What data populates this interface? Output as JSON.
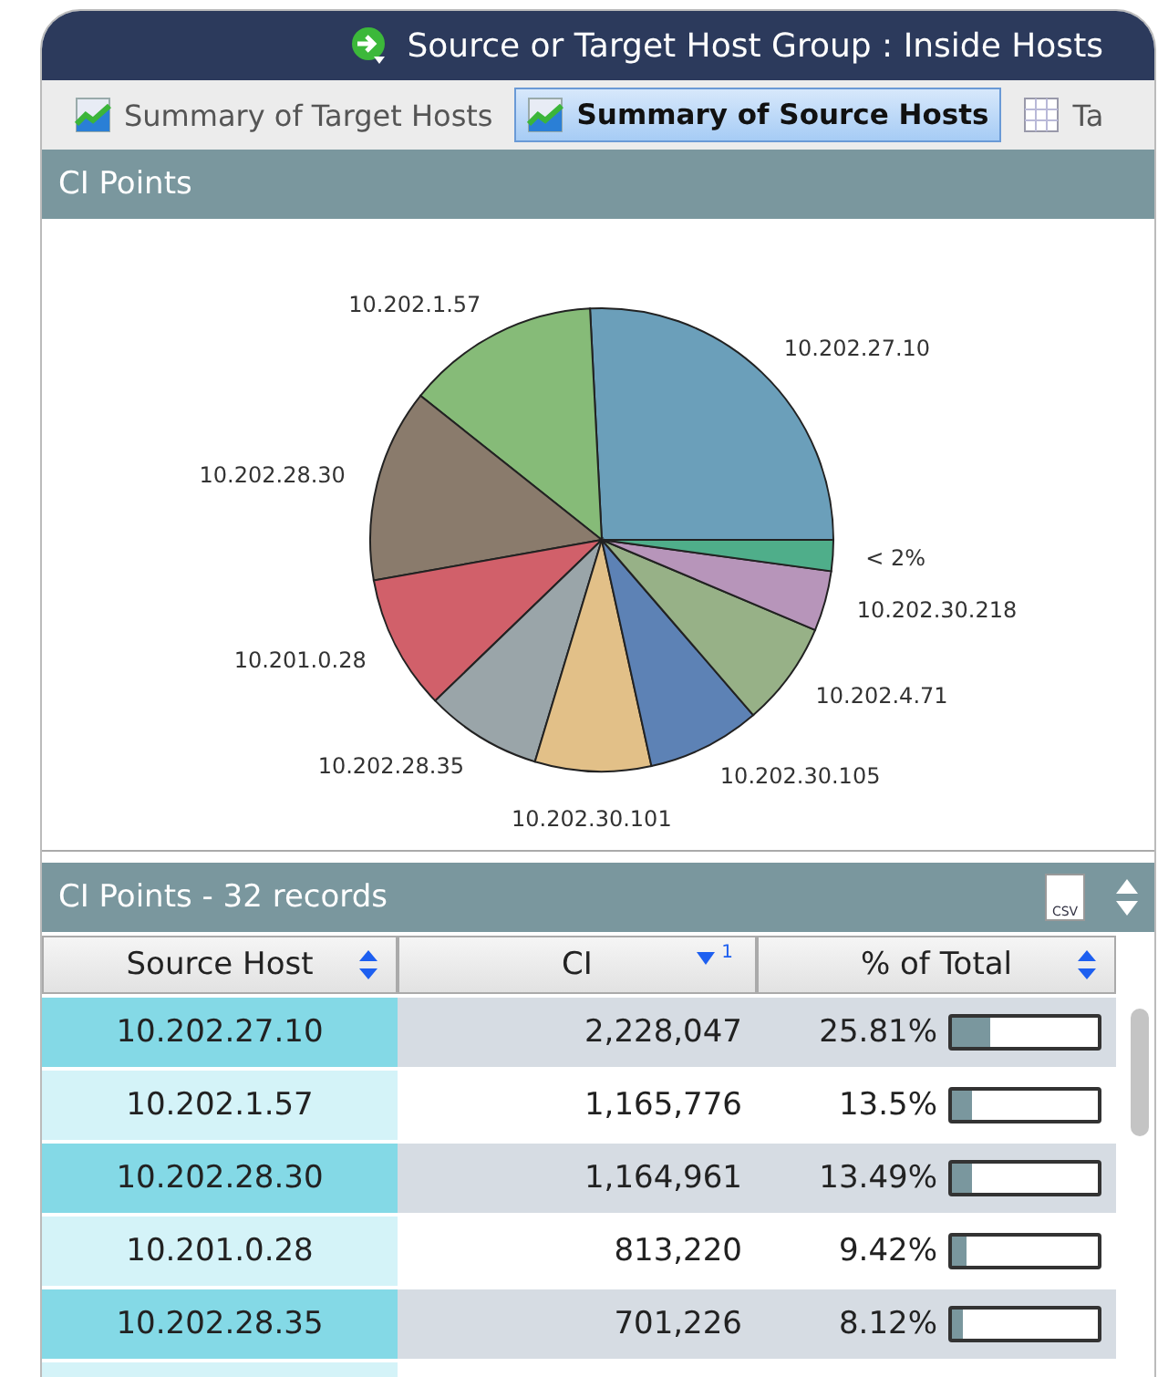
{
  "window": {
    "title": "Source or Target Host Group : Inside Hosts"
  },
  "tabs": [
    {
      "label": "Summary of Target Hosts",
      "kind": "chart",
      "selected": false
    },
    {
      "label": "Summary of Source Hosts",
      "kind": "chart",
      "selected": true
    },
    {
      "label": "Ta",
      "kind": "table",
      "selected": false
    }
  ],
  "chart_panel": {
    "title": "CI Points",
    "chart_data": {
      "type": "pie",
      "categories": [
        "10.202.27.10",
        "10.202.1.57",
        "10.202.28.30",
        "10.201.0.28",
        "10.202.28.35",
        "10.202.30.101",
        "10.202.30.105",
        "10.202.4.71",
        "10.202.30.218",
        "< 2%"
      ],
      "values": [
        25.81,
        13.5,
        13.49,
        9.42,
        8.12,
        8.1,
        7.9,
        7.3,
        4.2,
        2.16
      ],
      "colors": [
        "#6b9fba",
        "#86bb78",
        "#8a7b6c",
        "#d1606a",
        "#9aa5a9",
        "#e2c088",
        "#5d82b5",
        "#97b187",
        "#b795ba",
        "#4fae8a"
      ]
    }
  },
  "table_panel": {
    "title": "CI Points - 32 records",
    "export_label": "CSV",
    "columns": [
      {
        "label": "Source Host",
        "sorted": false
      },
      {
        "label": "CI",
        "sorted": true,
        "rank": "1"
      },
      {
        "label": "% of Total",
        "sorted": false
      }
    ],
    "rows": [
      {
        "host": "10.202.27.10",
        "ci": "2,228,047",
        "pct": "25.81%",
        "level": 0.2581
      },
      {
        "host": "10.202.1.57",
        "ci": "1,165,776",
        "pct": "13.5%",
        "level": 0.135
      },
      {
        "host": "10.202.28.30",
        "ci": "1,164,961",
        "pct": "13.49%",
        "level": 0.1349
      },
      {
        "host": "10.201.0.28",
        "ci": "813,220",
        "pct": "9.42%",
        "level": 0.0942
      },
      {
        "host": "10.202.28.35",
        "ci": "701,226",
        "pct": "8.12%",
        "level": 0.0812
      }
    ]
  }
}
